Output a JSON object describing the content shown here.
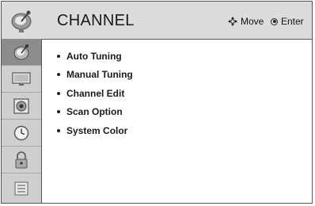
{
  "header": {
    "title": "CHANNEL",
    "icon": "satellite-dish-icon",
    "hints": {
      "move_label": "Move",
      "move_icon": "four-way-arrow-icon",
      "enter_label": "Enter",
      "enter_icon": "enter-button-icon"
    }
  },
  "sidebar": {
    "items": [
      {
        "icon": "satellite-dish-icon",
        "active": true
      },
      {
        "icon": "tv-screen-icon",
        "active": false
      },
      {
        "icon": "speaker-icon",
        "active": false
      },
      {
        "icon": "clock-icon",
        "active": false
      },
      {
        "icon": "lock-icon",
        "active": false
      },
      {
        "icon": "options-box-icon",
        "active": false
      }
    ]
  },
  "menu": {
    "items": [
      {
        "label": "Auto Tuning"
      },
      {
        "label": "Manual Tuning"
      },
      {
        "label": "Channel Edit"
      },
      {
        "label": "Scan Option"
      },
      {
        "label": "System Color"
      }
    ]
  },
  "colors": {
    "header_bg": "#dcdcdc",
    "sidebar_bg": "#cfcfcf",
    "active_item_bg": "#8c8c8c"
  }
}
